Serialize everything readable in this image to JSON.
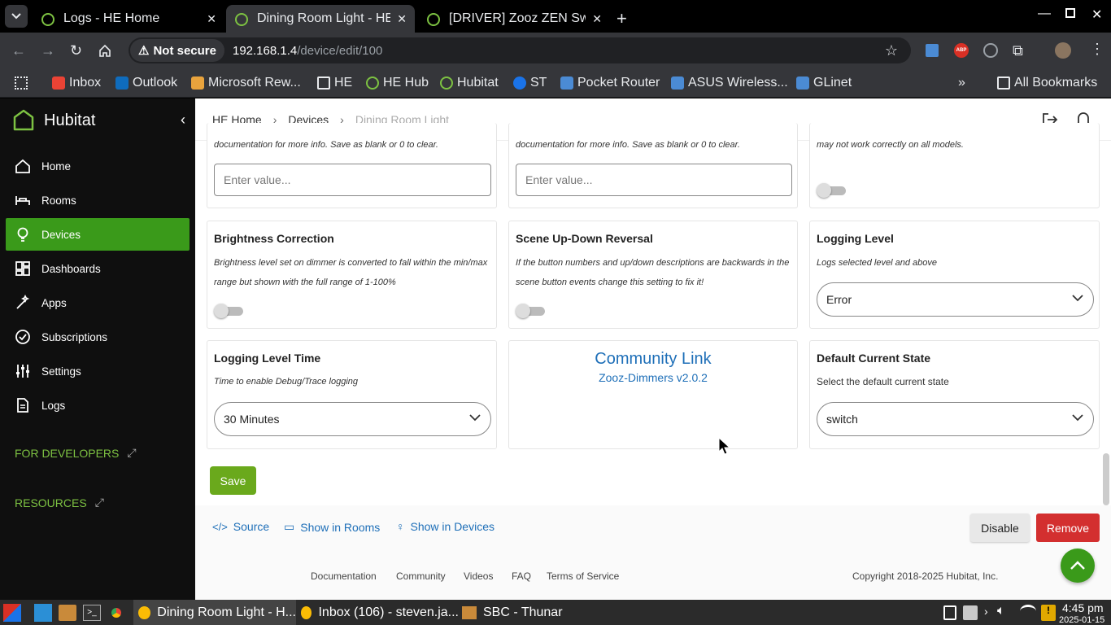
{
  "browser": {
    "tabs": [
      {
        "title": "Logs - HE Home",
        "active": false
      },
      {
        "title": "Dining Room Light - HE Home",
        "active": true
      },
      {
        "title": "[DRIVER] Zooz ZEN Switches",
        "active": false
      }
    ],
    "security_label": "Not secure",
    "url_host": "192.168.1.4",
    "url_path": "/device/edit/100",
    "bookmarks": [
      {
        "label": "Inbox",
        "color": "#ea4335"
      },
      {
        "label": "Outlook",
        "color": "#0f6cbd"
      },
      {
        "label": "Microsoft Rew...",
        "color": "#e8a33d"
      },
      {
        "label": "HE",
        "color": "#e8eaed"
      },
      {
        "label": "HE Hub",
        "color": "#7dc242"
      },
      {
        "label": "Hubitat",
        "color": "#7dc242"
      },
      {
        "label": "ST",
        "color": "#1a73e8"
      },
      {
        "label": "Pocket Router",
        "color": "#4b8bd4"
      },
      {
        "label": "ASUS Wireless...",
        "color": "#4b8bd4"
      },
      {
        "label": "GLinet",
        "color": "#4b8bd4"
      }
    ],
    "all_bookmarks": "All Bookmarks"
  },
  "app": {
    "brand": "Hubitat",
    "nav": [
      {
        "label": "Home",
        "icon": "home-icon"
      },
      {
        "label": "Rooms",
        "icon": "bed-icon"
      },
      {
        "label": "Devices",
        "icon": "bulb-icon",
        "active": true
      },
      {
        "label": "Dashboards",
        "icon": "dashboard-icon"
      },
      {
        "label": "Apps",
        "icon": "wand-icon"
      },
      {
        "label": "Subscriptions",
        "icon": "check-circle-icon"
      },
      {
        "label": "Settings",
        "icon": "sliders-icon"
      },
      {
        "label": "Logs",
        "icon": "document-icon"
      }
    ],
    "for_developers": "FOR DEVELOPERS",
    "resources": "RESOURCES"
  },
  "breadcrumb": {
    "home": "HE Home",
    "devices": "Devices",
    "current": "Dining Room Light"
  },
  "prefs": {
    "top_desc_1": "documentation for more info. Save as blank or 0 to clear.",
    "top_desc_2": "documentation for more info. Save as blank or 0 to clear.",
    "top_desc_3": "may not work correctly on all models.",
    "input_placeholder": "Enter value...",
    "brightness": {
      "title": "Brightness Correction",
      "desc": "Brightness level set on dimmer is converted to fall within the min/max range but shown with the full range of 1-100%"
    },
    "scene": {
      "title": "Scene Up-Down Reversal",
      "desc": "If the button numbers and up/down descriptions are backwards in the scene button events change this setting to fix it!"
    },
    "logging": {
      "title": "Logging Level",
      "desc": "Logs selected level and above",
      "value": "Error"
    },
    "logtime": {
      "title": "Logging Level Time",
      "desc": "Time to enable Debug/Trace logging",
      "value": "30 Minutes"
    },
    "community": {
      "title": "Community Link",
      "sub": "Zooz-Dimmers v2.0.2"
    },
    "default_state": {
      "title": "Default Current State",
      "desc": "Select the default current state",
      "value": "switch"
    }
  },
  "actions": {
    "save": "Save",
    "source": "Source",
    "show_rooms": "Show in Rooms",
    "show_devices": "Show in Devices",
    "disable": "Disable",
    "remove": "Remove"
  },
  "footer": {
    "links": [
      "Documentation",
      "Community",
      "Videos",
      "FAQ",
      "Terms of Service"
    ],
    "copyright": "Copyright 2018-2025 Hubitat, Inc."
  },
  "taskbar": {
    "windows": [
      "Dining Room Light - H...",
      "Inbox (106) - steven.ja...",
      "SBC - Thunar"
    ],
    "time": "4:45 pm",
    "date": "2025-01-15"
  }
}
